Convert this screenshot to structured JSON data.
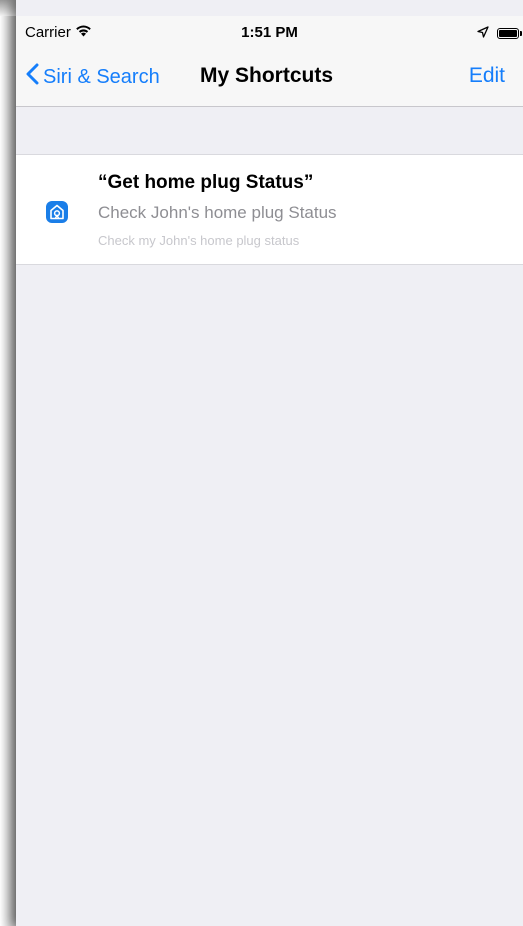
{
  "status_bar": {
    "carrier": "Carrier",
    "time": "1:51 PM",
    "wifi_icon": "wifi-icon",
    "location_icon": "location-arrow-icon",
    "battery_icon": "battery-icon"
  },
  "nav": {
    "back_label": "Siri & Search",
    "back_icon": "chevron-left-icon",
    "title": "My Shortcuts",
    "edit_label": "Edit"
  },
  "shortcuts": [
    {
      "icon": "home-plug-app-icon",
      "title": "“Get home plug Status”",
      "subtitle": "Check John's home plug Status",
      "phrase": "Check my John's home plug status"
    }
  ],
  "colors": {
    "accent": "#157efb",
    "background": "#efeff4",
    "app_icon": "#1a7ee8",
    "secondary_text": "#8e8e93",
    "tertiary_text": "#c7c7cc"
  }
}
